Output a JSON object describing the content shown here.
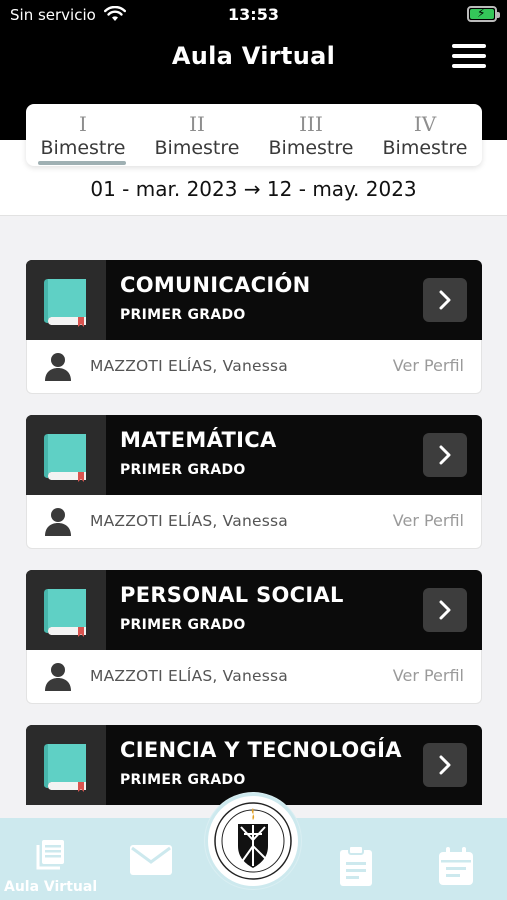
{
  "status_bar": {
    "carrier": "Sin servicio",
    "time": "13:53"
  },
  "header": {
    "title": "Aula Virtual"
  },
  "periods": {
    "tabs": [
      {
        "roman": "I",
        "label": "Bimestre",
        "active": true
      },
      {
        "roman": "II",
        "label": "Bimestre",
        "active": false
      },
      {
        "roman": "III",
        "label": "Bimestre",
        "active": false
      },
      {
        "roman": "IV",
        "label": "Bimestre",
        "active": false
      }
    ],
    "date_range": "01 - mar. 2023 → 12 - may. 2023"
  },
  "courses": [
    {
      "name": "COMUNICACIÓN",
      "grade": "PRIMER GRADO",
      "teacher": "MAZZOTI ELÍAS, Vanessa",
      "profile_link": "Ver Perfil"
    },
    {
      "name": "MATEMÁTICA",
      "grade": "PRIMER GRADO",
      "teacher": "MAZZOTI ELÍAS, Vanessa",
      "profile_link": "Ver Perfil"
    },
    {
      "name": "PERSONAL SOCIAL",
      "grade": "PRIMER GRADO",
      "teacher": "MAZZOTI ELÍAS, Vanessa",
      "profile_link": "Ver Perfil"
    },
    {
      "name": "CIENCIA Y TECNOLOGÍA",
      "grade": "PRIMER GRADO",
      "teacher": "",
      "profile_link": ""
    }
  ],
  "bottom_nav": {
    "items": [
      {
        "icon": "book-stack-icon",
        "label": "Aula Virtual"
      },
      {
        "icon": "mail-icon"
      },
      {
        "icon": "crest-logo"
      },
      {
        "icon": "clipboard-icon"
      },
      {
        "icon": "calendar-icon"
      }
    ]
  },
  "colors": {
    "header_bg": "#000000",
    "card_head_bg": "#0b0b0b",
    "book_teal": "#5fd0c5",
    "nav_bg": "#cde9ee"
  }
}
